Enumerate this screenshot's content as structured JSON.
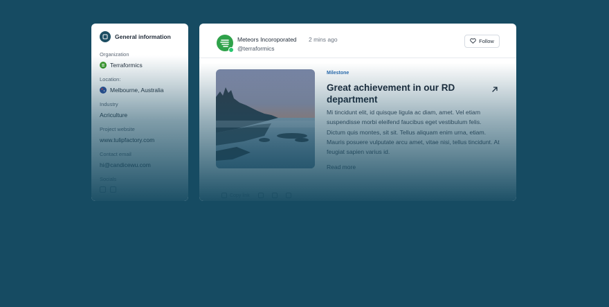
{
  "general": {
    "title": "General information",
    "organization": {
      "label": "Organization",
      "value": "Terraformics"
    },
    "location": {
      "label": "Location:",
      "value": "Melbourne, Australia"
    },
    "industry": {
      "label": "Industry",
      "value": "Acriculture"
    },
    "website": {
      "label": "Project website",
      "value": "www.tulipfactory.com"
    },
    "email": {
      "label": "Contact email",
      "value": "hi@candicewu.com"
    },
    "socials": {
      "label": "Socials"
    }
  },
  "post": {
    "author": "Meteors Incoroporated",
    "time": "2 mins ago",
    "handle": "@terraformics",
    "follow_label": "Follow",
    "tag": "Milestone",
    "headline": "Great achievement in our RD department",
    "body": "Mi tincidunt elit, id quisque ligula ac diam, amet. Vel etiam suspendisse morbi eleifend faucibus eget vestibulum felis. Dictum quis montes, sit sit. Tellus aliquam enim urna, etiam. Mauris posuere vulputate arcu amet, vitae nisi, tellus tincidunt. At feugiat sapien varius id.",
    "read_more": "Read more",
    "actions": {
      "copy_label": "Copy link"
    }
  },
  "colors": {
    "background": "#164b62",
    "card": "#ffffff",
    "accent": "#2b6cb0",
    "online": "#28c76f"
  },
  "icons": {
    "general": "info-square-icon",
    "organization": "terraformics-logo-icon",
    "location": "australia-flag-icon",
    "follow": "heart-icon",
    "open": "arrow-up-right-icon"
  }
}
